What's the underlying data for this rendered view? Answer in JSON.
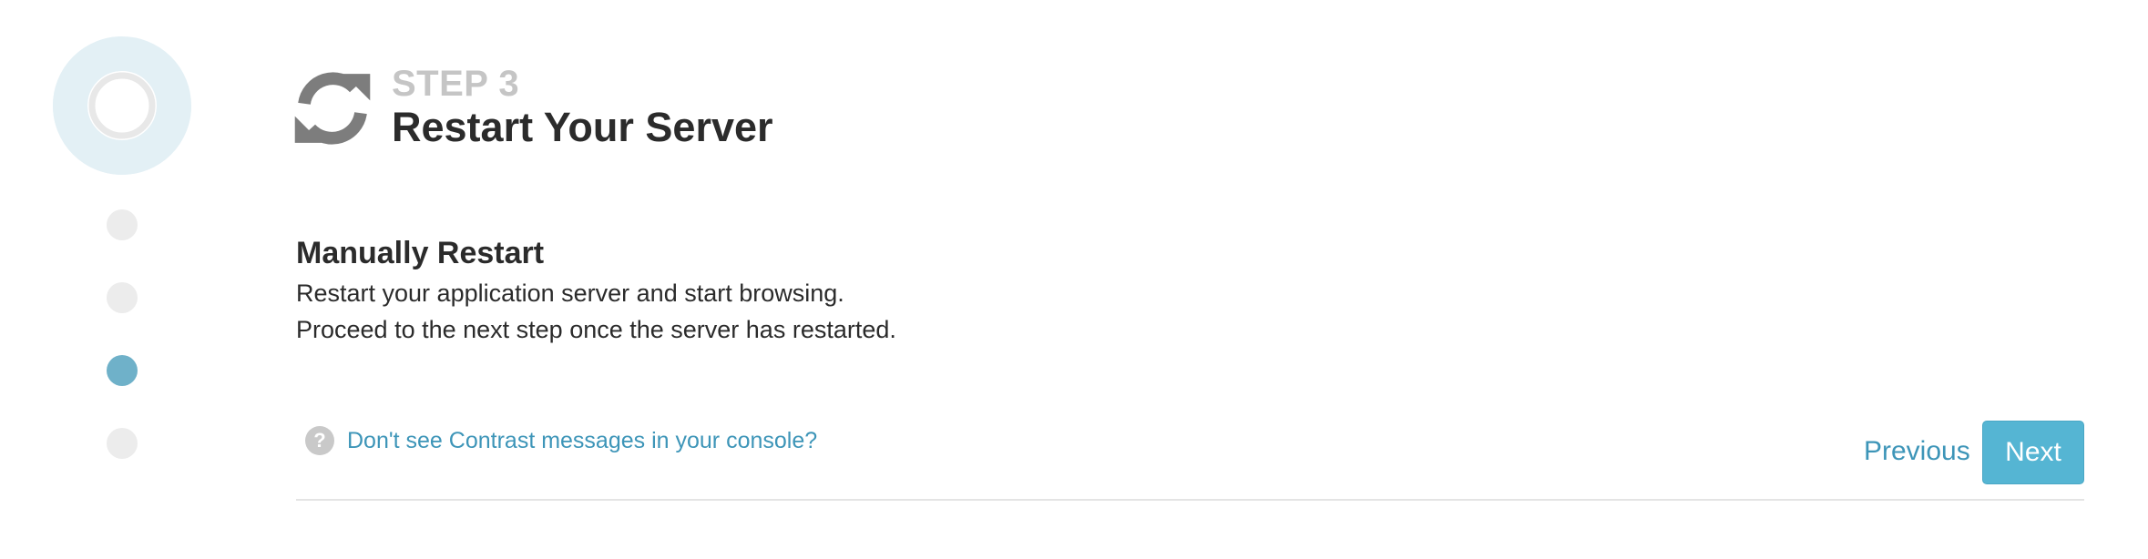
{
  "progress": {
    "completed_fraction": 0.75,
    "steps_total": 4,
    "current_step": 3
  },
  "header": {
    "eyebrow": "STEP 3",
    "title": "Restart Your Server",
    "icon": "refresh-icon"
  },
  "main": {
    "heading": "Manually Restart",
    "lines": [
      "Restart your application server and start browsing.",
      "Proceed to the next step once the server has restarted."
    ]
  },
  "help": {
    "icon": "question-icon",
    "icon_glyph": "?",
    "link_text": "Don't see Contrast messages in your console?"
  },
  "actions": {
    "previous_label": "Previous",
    "next_label": "Next"
  },
  "colors": {
    "accent": "#55b5d3",
    "link": "#3d95b8",
    "active_step": "#6fb1c9",
    "inactive_step": "#ececec",
    "ring_track": "#e3f0f5"
  }
}
